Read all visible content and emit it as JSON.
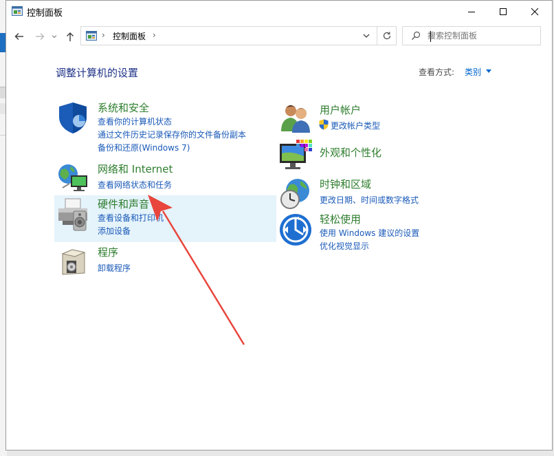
{
  "window": {
    "title": "控制面板"
  },
  "address": {
    "crumb": "控制面板",
    "sep": "›"
  },
  "search": {
    "placeholder": "搜索控制面板"
  },
  "heading": "调整计算机的设置",
  "view": {
    "label": "查看方式:",
    "value": "类别"
  },
  "categories": {
    "system": {
      "title": "系统和安全",
      "links": [
        "查看你的计算机状态",
        "通过文件历史记录保存你的文件备份副本",
        "备份和还原(Windows 7)"
      ],
      "icon": "shield-icon"
    },
    "network": {
      "title": "网络和 Internet",
      "links": [
        "查看网络状态和任务"
      ],
      "icon": "globe-network-icon"
    },
    "hardware": {
      "title": "硬件和声音",
      "links": [
        "查看设备和打印机",
        "添加设备"
      ],
      "icon": "printer-icon"
    },
    "programs": {
      "title": "程序",
      "links": [
        "卸载程序"
      ],
      "icon": "programs-box-icon"
    },
    "users": {
      "title": "用户帐户",
      "links": [
        "更改帐户类型"
      ],
      "icon": "users-icon"
    },
    "appearance": {
      "title": "外观和个性化",
      "links": [],
      "icon": "monitor-palette-icon"
    },
    "clock": {
      "title": "时钟和区域",
      "links": [
        "更改日期、时间或数字格式"
      ],
      "icon": "clock-globe-icon"
    },
    "ease": {
      "title": "轻松使用",
      "links": [
        "使用 Windows 建议的设置",
        "优化视觉显示"
      ],
      "icon": "ease-of-access-icon"
    }
  },
  "colors": {
    "title_green": "#2d7d2d",
    "link_blue": "#1a5ab8",
    "heading_blue": "#1e3287",
    "highlight": "#e5f3fb",
    "annotation_red": "#e8453c"
  }
}
